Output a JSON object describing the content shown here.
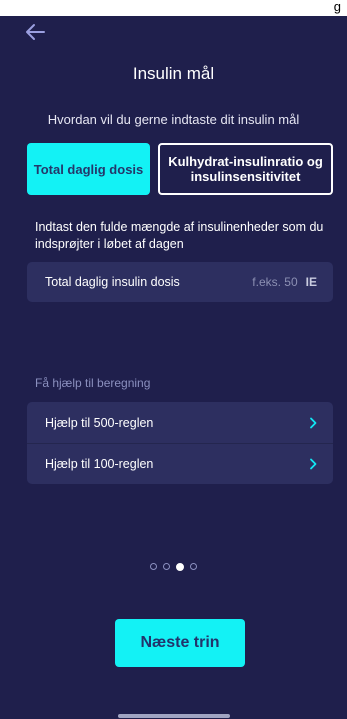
{
  "status_bar": {
    "fragment": "g"
  },
  "header": {
    "title": "Insulin mål"
  },
  "prompt": "Hvordan vil du gerne indtaste dit insulin mål",
  "options": {
    "total": "Total daglig dosis",
    "ratio": "Kulhydrat-insulinratio og insulinsensitivitet"
  },
  "description": "Indtast den fulde mængde af insulinenheder som du indsprøjter i løbet af dagen",
  "input": {
    "label": "Total daglig insulin dosis",
    "placeholder": "f.eks. 50",
    "unit": "IE"
  },
  "help": {
    "title": "Få hjælp til beregning",
    "items": [
      {
        "label": "Hjælp til 500-reglen"
      },
      {
        "label": "Hjælp til 100-reglen"
      }
    ]
  },
  "pagination": {
    "total": 4,
    "current": 3
  },
  "actions": {
    "next_label": "Næste trin"
  },
  "colors": {
    "background": "#1f1f4c",
    "accent": "#13f2f5",
    "card": "#2d2f60",
    "muted_text": "#8b90bf",
    "chevron": "#12e6f2"
  }
}
